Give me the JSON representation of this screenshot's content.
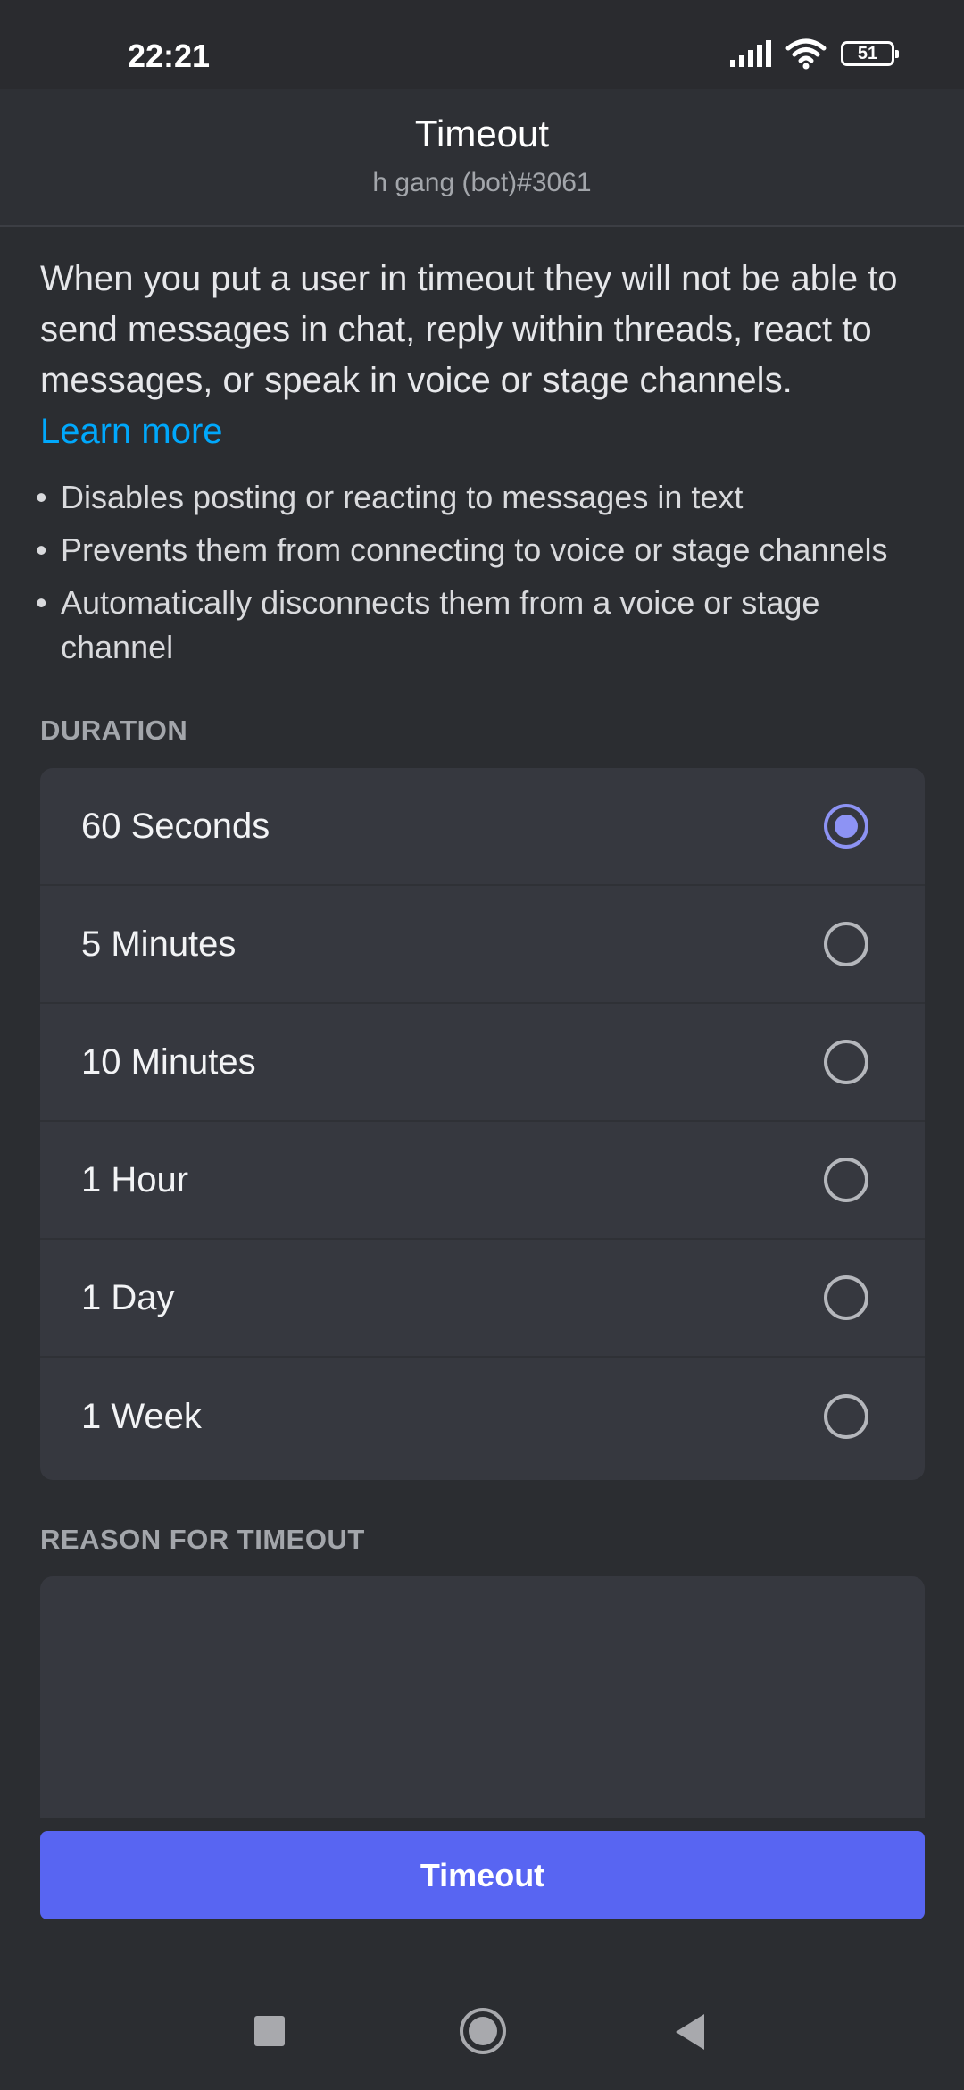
{
  "status_bar": {
    "time": "22:21",
    "battery": "51",
    "icons": [
      "signal-icon",
      "wifi-icon",
      "battery-icon"
    ]
  },
  "header": {
    "title": "Timeout",
    "subtitle": "h gang (bot)#3061"
  },
  "description": {
    "text": "When you put a user in timeout they will not be able to send messages in chat, reply within threads, react to messages, or speak in voice or stage channels.",
    "learn_more": "Learn more"
  },
  "bullets": [
    "Disables posting or reacting to messages in text",
    "Prevents them from connecting to voice or stage channels",
    "Automatically disconnects them from a voice or stage channel"
  ],
  "duration": {
    "label": "DURATION",
    "options": [
      {
        "label": "60 Seconds",
        "selected": true
      },
      {
        "label": "5 Minutes",
        "selected": false
      },
      {
        "label": "10 Minutes",
        "selected": false
      },
      {
        "label": "1 Hour",
        "selected": false
      },
      {
        "label": "1 Day",
        "selected": false
      },
      {
        "label": "1 Week",
        "selected": false
      }
    ]
  },
  "reason": {
    "label": "REASON FOR TIMEOUT",
    "value": ""
  },
  "actions": {
    "timeout_label": "Timeout"
  },
  "nav": {
    "icons": [
      "recent-apps-icon",
      "home-icon",
      "back-icon"
    ]
  },
  "colors": {
    "background": "#2b2d31",
    "card": "#36383f",
    "accent": "#5865f2",
    "radio_selected": "#8d93f4",
    "link": "#00a8fc"
  }
}
